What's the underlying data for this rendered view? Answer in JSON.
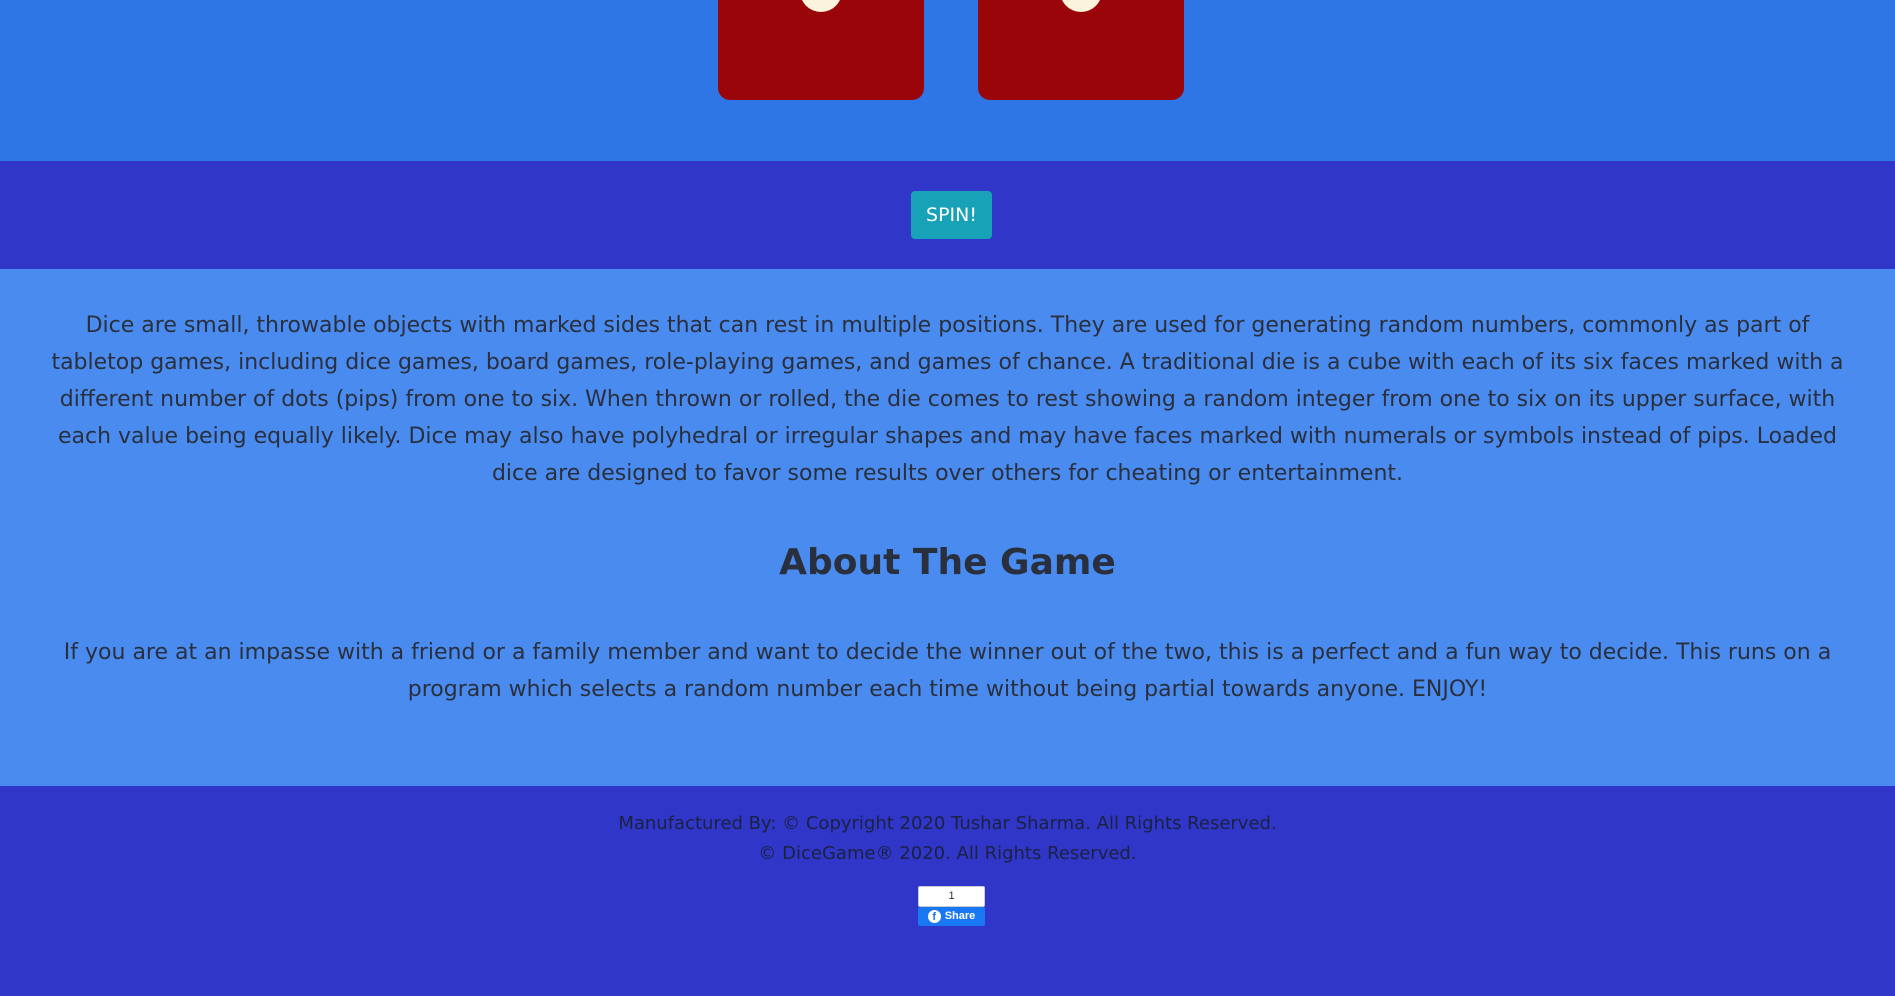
{
  "dice": {
    "left_icon": "die-face-icon",
    "right_icon": "die-face-icon",
    "die_color": "#9a0509",
    "pip_color": "#fbf3dc"
  },
  "controls": {
    "spin_label": "SPIN!",
    "spin_color": "#17a2b8"
  },
  "content": {
    "description": "Dice are small, throwable objects with marked sides that can rest in multiple positions. They are used for generating random numbers, commonly as part of tabletop games, including dice games, board games, role-playing games, and games of chance. A traditional die is a cube with each of its six faces marked with a different number of dots (pips) from one to six. When thrown or rolled, the die comes to rest showing a random integer from one to six on its upper surface, with each value being equally likely. Dice may also have polyhedral or irregular shapes and may have faces marked with numerals or symbols instead of pips. Loaded dice are designed to favor some results over others for cheating or entertainment.",
    "about_title": "About The Game",
    "about_text": "If you are at an impasse with a friend or a family member and want to decide the winner out of the two, this is a perfect and a fun way to decide. This runs on a program which selects a random number each time without being partial towards anyone. ENJOY!"
  },
  "footer": {
    "line1": "Manufactured By: © Copyright 2020 Tushar Sharma. All Rights Reserved.",
    "line2": "© DiceGame® 2020. All Rights Reserved.",
    "share_count": "1",
    "share_label": "Share",
    "share_icon": "facebook-icon"
  },
  "colors": {
    "dice_band": "#2e76e6",
    "spin_band": "#2f36c8",
    "content_band": "#4a8bef",
    "footer_band": "#2f36c8",
    "facebook_blue": "#1877f2"
  }
}
